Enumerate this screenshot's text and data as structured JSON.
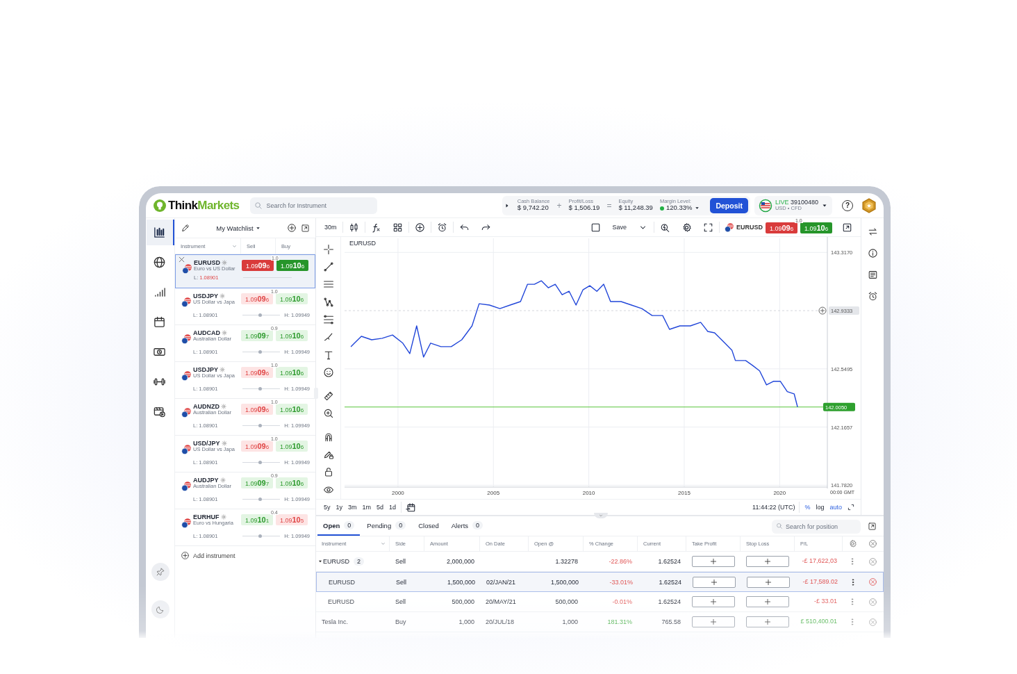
{
  "header": {
    "logo": {
      "text": "Think",
      "accent": "Markets"
    },
    "search": {
      "placeholder": "Search for Instrument"
    },
    "stats": [
      {
        "label": "Cash Balance",
        "value": "$ 9,742.20",
        "operator": "+"
      },
      {
        "label": "Profit/Loss",
        "value": "$ 1,506.19",
        "operator": "="
      },
      {
        "label": "Equity",
        "value": "$ 11,248.39"
      }
    ],
    "margin": {
      "label": "Margin Level:",
      "value": "120.33%"
    },
    "deposit": "Deposit",
    "account": {
      "mode": "LIVE",
      "number": "39100480",
      "detail": "USD • CFD"
    },
    "help": "?"
  },
  "rail": [
    {
      "kind": "chart",
      "selected": true
    },
    {
      "kind": "globe",
      "selected": false
    },
    {
      "kind": "signal",
      "selected": false
    },
    {
      "kind": "calendar",
      "selected": false
    },
    {
      "kind": "money",
      "selected": false
    },
    {
      "kind": "dumbbell",
      "selected": false
    },
    {
      "kind": "video",
      "selected": false
    }
  ],
  "rail_bottom": [
    {
      "kind": "pin"
    },
    {
      "kind": "moon"
    }
  ],
  "watchlist": {
    "title": "My Watchlist",
    "columns": [
      "Instrument",
      "Sell",
      "Buy"
    ],
    "items": [
      {
        "symbol": "EURUSD",
        "name": "Euro vs US Dollar",
        "sell": "1.09096",
        "sell_up": false,
        "spread": "1.0",
        "buy": "1.09106",
        "buy_up": true,
        "low_label": "L:",
        "low": "1.08901",
        "selected": true
      },
      {
        "symbol": "USDJPY",
        "name": "US Dollar vs Japa",
        "sell": "1.09096",
        "sell_up": false,
        "spread": "1.0",
        "buy": "1.09106",
        "buy_up": true,
        "low_label": "L:",
        "low": "1.08901",
        "high_label": "H:",
        "high": "1.09949",
        "level": 0.47,
        "selected": false
      },
      {
        "symbol": "AUDCAD",
        "name": "Australian Dollar",
        "sell": "1.09097",
        "sell_up": true,
        "spread": "0.9",
        "buy": "1.09106",
        "buy_up": true,
        "low_label": "L:",
        "low": "1.08901",
        "high_label": "H:",
        "high": "1.09949",
        "level": 0.47,
        "selected": false
      },
      {
        "symbol": "USDJPY",
        "name": "US Dollar vs Japa",
        "sell": "1.09096",
        "sell_up": false,
        "spread": "1.0",
        "buy": "1.09106",
        "buy_up": true,
        "low_label": "L:",
        "low": "1.08901",
        "high_label": "H:",
        "high": "1.09949",
        "level": 0.47,
        "selected": false
      },
      {
        "symbol": "AUDNZD",
        "name": "Australian Dollar",
        "sell": "1.09096",
        "sell_up": false,
        "spread": "1.0",
        "buy": "1.09106",
        "buy_up": true,
        "low_label": "L:",
        "low": "1.08901",
        "high_label": "H:",
        "high": "1.09949",
        "level": 0.47,
        "selected": false
      },
      {
        "symbol": "USD/JPY",
        "name": "US Dollar vs Japa",
        "sell": "1.09096",
        "sell_up": false,
        "spread": "1.0",
        "buy": "1.09106",
        "buy_up": true,
        "low_label": "L:",
        "low": "1.08901",
        "high_label": "H:",
        "high": "1.09949",
        "level": 0.47,
        "selected": false
      },
      {
        "symbol": "AUDJPY",
        "name": "Australian Dollar",
        "sell": "1.09097",
        "sell_up": true,
        "spread": "0.9",
        "buy": "1.09106",
        "buy_up": true,
        "low_label": "L:",
        "low": "1.08901",
        "high_label": "H:",
        "high": "1.09949",
        "level": 0.47,
        "selected": false
      },
      {
        "symbol": "EURHUF",
        "name": "Euro vs Hungaria",
        "sell": "1.09101",
        "sell_up": true,
        "spread": "0.4",
        "buy": "1.09105",
        "buy_up": false,
        "low_label": "L:",
        "low": "1.08901",
        "high_label": "H:",
        "high": "1.09949",
        "level": 0.47,
        "selected": false
      }
    ],
    "add": "Add instrument"
  },
  "chart": {
    "interval": "30m",
    "save": "Save",
    "quote": {
      "symbol": "EURUSD",
      "sell": "1.09096",
      "spread": "1.0",
      "buy": "1.09106"
    },
    "chart_data": {
      "type": "line",
      "title": "EURUSD",
      "x": [
        1997.53,
        1998.08,
        1998.62,
        1999.17,
        1999.71,
        2000.25,
        2000.62,
        2000.98,
        2001.34,
        2001.71,
        2002.25,
        2002.79,
        2003.34,
        2003.88,
        2004.25,
        2004.79,
        2005.34,
        2005.88,
        2006.42,
        2006.79,
        2007.15,
        2007.51,
        2007.88,
        2008.24,
        2008.6,
        2008.97,
        2009.33,
        2009.69,
        2010.05,
        2010.42,
        2010.78,
        2011.14,
        2011.69,
        2012.23,
        2012.78,
        2013.32,
        2013.87,
        2014.23,
        2014.77,
        2015.32,
        2015.86,
        2016.23,
        2016.59,
        2017.13,
        2017.5,
        2017.68,
        2018.22,
        2018.58,
        2018.95,
        2019.31,
        2019.67,
        2020.04,
        2020.4,
        2020.76,
        2020.94
      ],
      "series": [
        {
          "color": "#2146d9",
          "values": [
            142.696,
            142.764,
            142.741,
            142.751,
            142.773,
            142.719,
            142.65,
            142.833,
            142.627,
            142.719,
            142.696,
            142.696,
            142.741,
            142.833,
            142.979,
            142.97,
            142.947,
            142.97,
            142.993,
            143.107,
            143.107,
            143.13,
            143.084,
            143.107,
            143.038,
            143.061,
            142.97,
            143.07,
            143.098,
            143.061,
            143.107,
            142.993,
            142.993,
            142.97,
            142.947,
            142.901,
            142.901,
            142.81,
            142.833,
            142.833,
            142.856,
            142.796,
            142.787,
            142.719,
            142.673,
            142.604,
            142.604,
            142.572,
            142.536,
            142.444,
            142.467,
            142.467,
            142.399,
            142.385,
            142.298
          ]
        }
      ],
      "xlim": [
        1997.2,
        2022.5
      ],
      "ylim": [
        141.77,
        143.41
      ],
      "xticks": [
        2000,
        2005,
        2010,
        2015,
        2020
      ],
      "yticks": [
        {
          "value": 141.782,
          "label": "141.7820"
        },
        {
          "value": 142.1657,
          "label": "142.1657"
        },
        {
          "value": 142.5495,
          "label": "142.5495"
        },
        {
          "value": 143.317,
          "label": "143.3170"
        }
      ],
      "grid": true,
      "ref_lines": [
        {
          "axis": "y",
          "value": 142.9333,
          "label": "142.9333",
          "color": "#d4d7dd"
        },
        {
          "axis": "y",
          "value": 142.298,
          "color": "#58c43b"
        }
      ]
    },
    "last_price": {
      "label": "142.0050"
    },
    "axis_note": "00:00 GMT",
    "ranges": [
      "5y",
      "1y",
      "3m",
      "1m",
      "5d",
      "1d"
    ],
    "time": "11:44:22 (UTC)",
    "scales": [
      {
        "label": "%",
        "on": true
      },
      {
        "label": "log",
        "on": false
      },
      {
        "label": "auto",
        "on": true
      }
    ]
  },
  "positions": {
    "tabs": [
      {
        "label": "Open",
        "count": "0",
        "selected": true
      },
      {
        "label": "Pending",
        "count": "0",
        "selected": false
      },
      {
        "label": "Closed",
        "selected": false
      },
      {
        "label": "Alerts",
        "count": "0",
        "selected": false
      }
    ],
    "search": {
      "placeholder": "Search for position"
    },
    "columns": [
      "Instrument",
      "Side",
      "Amount",
      "On Date",
      "Open @",
      "% Change",
      "Current",
      "Take Profit",
      "Stop Loss",
      "P/L"
    ],
    "rows": [
      {
        "kind": "group",
        "instrument": "EURUSD",
        "count": "2",
        "expanded": true,
        "side": "Sell",
        "amount": "2,000,000",
        "open_at": "1.32278",
        "change": "-22.86%",
        "up": false,
        "current": "1.62524",
        "pl": "-£ 17,622,03",
        "selected": false
      },
      {
        "kind": "position",
        "instrument": "EURUSD",
        "side": "Sell",
        "amount": "1,500,000",
        "date": "02/JAN/21",
        "open_at": "1,500,000",
        "change": "-33.01%",
        "up": false,
        "current": "1.62524",
        "pl": "-£ 17,589.02",
        "selected": true
      },
      {
        "kind": "position",
        "instrument": "EURUSD",
        "side": "Sell",
        "amount": "500,000",
        "date": "20/MAY/21",
        "open_at": "500,000",
        "change": "-0.01%",
        "up": false,
        "current": "1.62524",
        "pl": "-£ 33.01",
        "selected": false
      },
      {
        "kind": "group",
        "instrument": "Tesla Inc.",
        "side": "Buy",
        "amount": "1,000",
        "date": "20/JUL/18",
        "open_at": "1,000",
        "change": "181.31%",
        "up": true,
        "current": "765.58",
        "pl": "£ 510,400.01",
        "selected": false
      }
    ]
  }
}
